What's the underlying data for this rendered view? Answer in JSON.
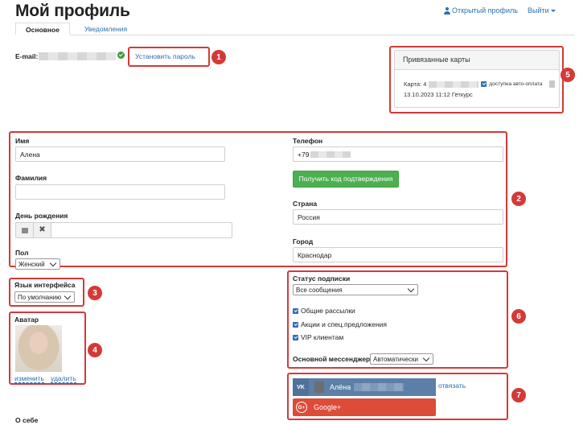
{
  "header": {
    "title": "Мой профиль",
    "profile_link": "Открытый профиль",
    "logout": "Выйти"
  },
  "tabs": [
    {
      "label": "Основное",
      "active": true
    },
    {
      "label": "Уведомления",
      "active": false
    }
  ],
  "email": {
    "label": "E-mail:",
    "set_password": "Установить пароль"
  },
  "cards": {
    "title": "Привязанные карты",
    "card_prefix": "Карта: 4",
    "autopay_label": "доступна авто-оплата",
    "autopay_checked": true,
    "date_line": "13.10.2023 11:12 Геткурс"
  },
  "personal": {
    "name_label": "Имя",
    "name_value": "Алена",
    "surname_label": "Фамилия",
    "surname_value": "",
    "birthday_label": "День рождения",
    "clear_symbol": "✖",
    "gender_label": "Пол",
    "gender_value": "Женский",
    "phone_label": "Телефон",
    "phone_value": "+79",
    "get_code": "Получить код подтверждения",
    "country_label": "Страна",
    "country_value": "Россия",
    "city_label": "Город",
    "city_value": "Краснодар"
  },
  "interface": {
    "label": "Язык интерфейса",
    "value": "По умолчанию"
  },
  "avatar": {
    "label": "Аватар",
    "change": "изменить",
    "delete": "удалить"
  },
  "subscription": {
    "label": "Статус подписки",
    "value": "Все сообщения",
    "options": [
      {
        "label": "Общие рассылки",
        "checked": true
      },
      {
        "label": "Акции и спец.предложения",
        "checked": true
      },
      {
        "label": "VIP клиентам",
        "checked": true
      }
    ],
    "messenger_label": "Основной мессенджер",
    "messenger_value": "Автоматически"
  },
  "social": {
    "vk_icon": "VK",
    "vk_name": "Алёна",
    "unlink": "отвязать",
    "google_icon": "G+",
    "google": "Google+"
  },
  "about": {
    "label": "О себе"
  },
  "badges": [
    "1",
    "2",
    "3",
    "4",
    "5",
    "6",
    "7"
  ],
  "colors": {
    "accent": "#2f6fb3",
    "highlight": "#d33a37",
    "green": "#4caf50",
    "vk": "#5b7fa6",
    "google": "#dd4b39"
  }
}
